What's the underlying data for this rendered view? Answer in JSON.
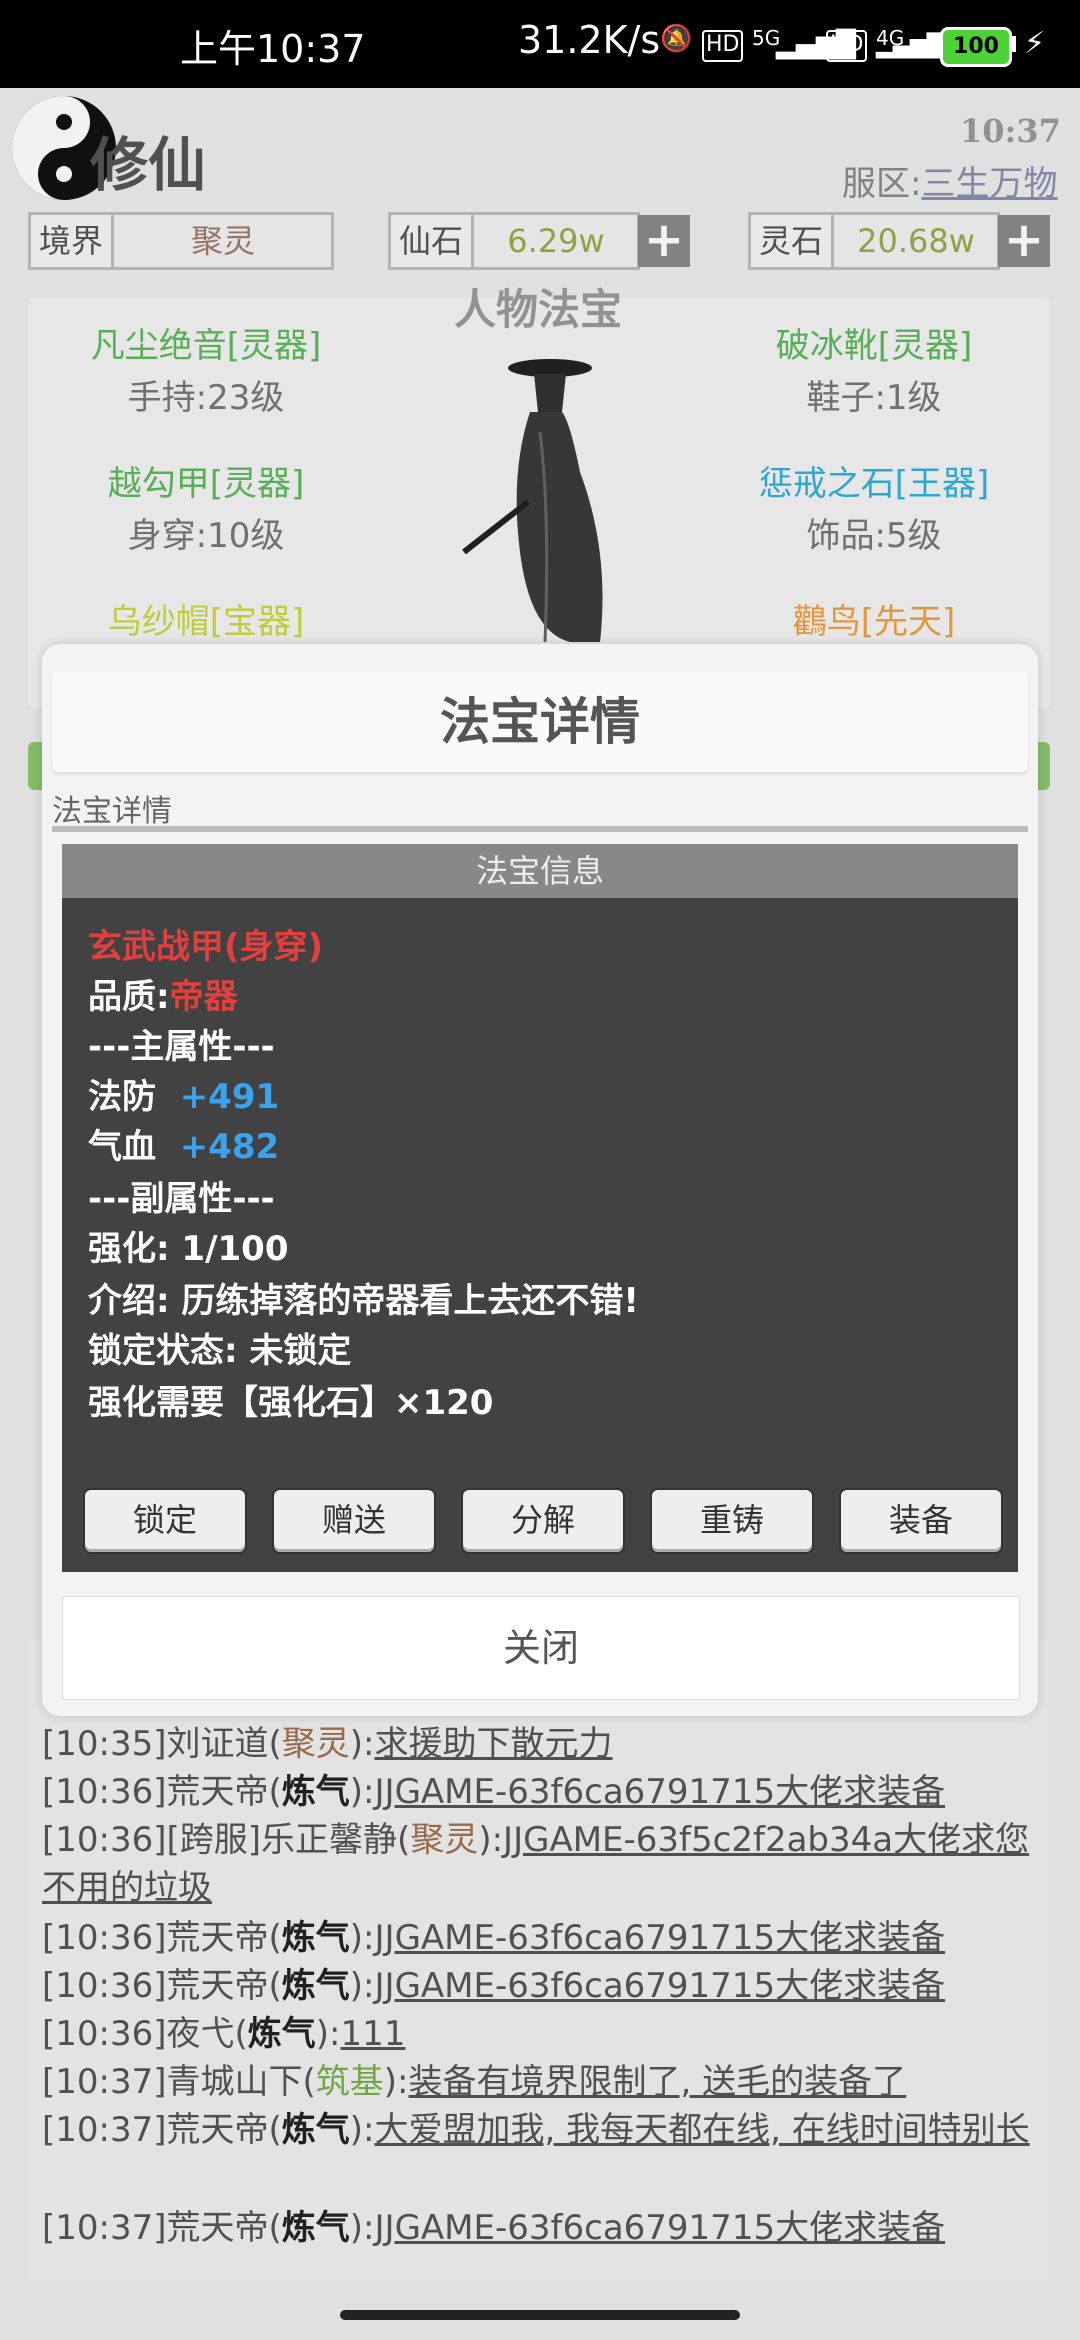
{
  "status_bar": {
    "time": "上午10:37",
    "net_speed": "31.2K/s",
    "network": "5G",
    "network2": "4G",
    "battery": "100"
  },
  "header": {
    "app_title": "修仙",
    "clock": "10:37",
    "server_label": "服区:",
    "server_name": "三生万物",
    "realm_label": "境界",
    "realm_value": "聚灵",
    "xianshi_label": "仙石",
    "xianshi_value": "6.29w",
    "lingshi_label": "灵石",
    "lingshi_value": "20.68w",
    "plus_symbol": "+"
  },
  "equipment": {
    "title": "人物法宝",
    "items": [
      {
        "name": "凡尘绝音[灵器]",
        "level": "手持:23级",
        "color": "#5cb85c"
      },
      {
        "name": "越勾甲[灵器]",
        "level": "身穿:10级",
        "color": "#5cb85c"
      },
      {
        "name": "乌纱帽[宝器]",
        "level": "",
        "color": "#c7d83a"
      },
      {
        "name": "破冰靴[灵器]",
        "level": "鞋子:1级",
        "color": "#5cb85c"
      },
      {
        "name": "惩戒之石[王器]",
        "level": "饰品:5级",
        "color": "#2fb0e0"
      },
      {
        "name": "鸛鸟[先天]",
        "level": "",
        "color": "#f0a040"
      }
    ]
  },
  "modal": {
    "title": "法宝详情",
    "subtitle": "法宝详情",
    "info_header": "法宝信息",
    "lines": {
      "item_name": "玄武战甲(身穿)",
      "quality_label": "品质:",
      "quality_value": "帝器",
      "main_attr": "---主属性---",
      "fafang_label": "法防",
      "fafang_value": "+491",
      "qixue_label": "气血",
      "qixue_value": "+482",
      "sub_attr": "---副属性---",
      "enhance": "强化: 1/100",
      "intro": "介绍: 历练掉落的帝器看上去还不错!",
      "lock_status": "锁定状态: 未锁定",
      "enhance_need": "强化需要【强化石】×120"
    },
    "buttons": [
      "锁定",
      "赠送",
      "分解",
      "重铸",
      "装备"
    ],
    "close_label": "关闭"
  },
  "chat": [
    {
      "time": "[10:35]",
      "user": "刘证道",
      "rank": "聚灵",
      "rank_color": "r2",
      "msg": "求援助下散元力"
    },
    {
      "time": "[10:36]",
      "user": "荒天帝",
      "rank": "炼气",
      "rank_color": "r1",
      "msg": "JJGAME-63f6ca6791715大佬求装备"
    },
    {
      "time": "[10:36]",
      "user": "[跨服]乐正馨静",
      "rank": "聚灵",
      "rank_color": "r2",
      "msg": "JJGAME-63f5c2f2ab34a大佬求您不用的垃圾"
    },
    {
      "time": "[10:36]",
      "user": "荒天帝",
      "rank": "炼气",
      "rank_color": "r1",
      "msg": "JJGAME-63f6ca6791715大佬求装备"
    },
    {
      "time": "[10:36]",
      "user": "荒天帝",
      "rank": "炼气",
      "rank_color": "r1",
      "msg": "JJGAME-63f6ca6791715大佬求装备"
    },
    {
      "time": "[10:36]",
      "user": "夜弋",
      "rank": "炼气",
      "rank_color": "r1",
      "msg": "111"
    },
    {
      "time": "[10:37]",
      "user": "青城山下",
      "rank": "筑基",
      "rank_color": "r3",
      "msg": "装备有境界限制了, 送毛的装备了"
    },
    {
      "time": "[10:37]",
      "user": "荒天帝",
      "rank": "炼气",
      "rank_color": "r1",
      "msg": "大爱盟加我, 我每天都在线, 在线时间特别长"
    },
    {
      "time": "[10:37]",
      "user": "荒天帝",
      "rank": "炼气",
      "rank_color": "r1",
      "msg": "JJGAME-63f6ca6791715大佬求装备"
    }
  ]
}
